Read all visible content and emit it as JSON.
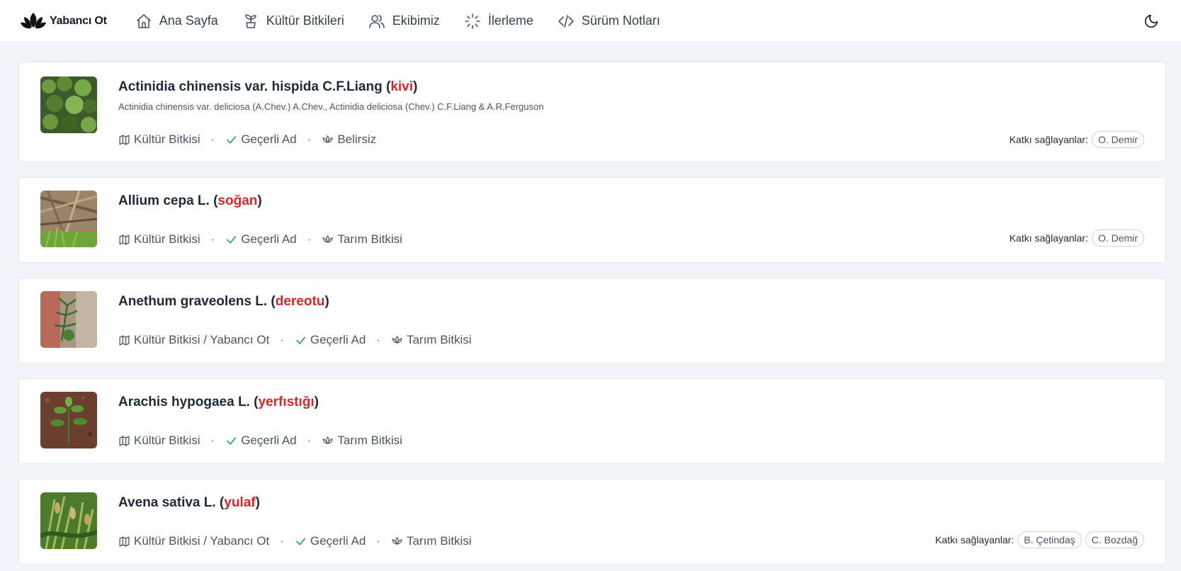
{
  "app": {
    "logo_text": "Yabancı Ot"
  },
  "nav": [
    {
      "label": "Ana Sayfa",
      "icon": "home-icon"
    },
    {
      "label": "Kültür Bitkileri",
      "icon": "sprout-icon"
    },
    {
      "label": "Ekibimiz",
      "icon": "users-icon"
    },
    {
      "label": "İlerleme",
      "icon": "loader-icon"
    },
    {
      "label": "Sürüm Notları",
      "icon": "code-icon"
    }
  ],
  "contrib_label": "Katkı sağlayanlar:",
  "plants": [
    {
      "name": "Actinidia chinensis var. hispida C.F.Liang",
      "common": "kivi",
      "synonyms": "Actinidia chinensis var. deliciosa (A.Chev.) A.Chev., Actinidia deliciosa (Chev.) C.F.Liang & A.R.Ferguson",
      "type": "Kültür Bitkisi",
      "status": "Geçerli Ad",
      "category": "Belirsiz",
      "contributors": [
        "O. Demir"
      ]
    },
    {
      "name": "Allium cepa L.",
      "common": "soğan",
      "synonyms": "",
      "type": "Kültür Bitkisi",
      "status": "Geçerli Ad",
      "category": "Tarım Bitkisi",
      "contributors": [
        "O. Demir"
      ]
    },
    {
      "name": "Anethum graveolens L.",
      "common": "dereotu",
      "synonyms": "",
      "type": "Kültür Bitkisi / Yabancı Ot",
      "status": "Geçerli Ad",
      "category": "Tarım Bitkisi",
      "contributors": []
    },
    {
      "name": "Arachis hypogaea L.",
      "common": "yerfıstığı",
      "synonyms": "",
      "type": "Kültür Bitkisi",
      "status": "Geçerli Ad",
      "category": "Tarım Bitkisi",
      "contributors": []
    },
    {
      "name": "Avena sativa L.",
      "common": "yulaf",
      "synonyms": "",
      "type": "Kültür Bitkisi / Yabancı Ot",
      "status": "Geçerli Ad",
      "category": "Tarım Bitkisi",
      "contributors": [
        "B. Çetindaş",
        "C. Bozdağ"
      ]
    }
  ],
  "colors": {
    "accent_common_name": "#dc2626",
    "check_green": "#16a34a",
    "background": "#f1f4f8"
  },
  "theme_toggle_icon": "moon-icon"
}
